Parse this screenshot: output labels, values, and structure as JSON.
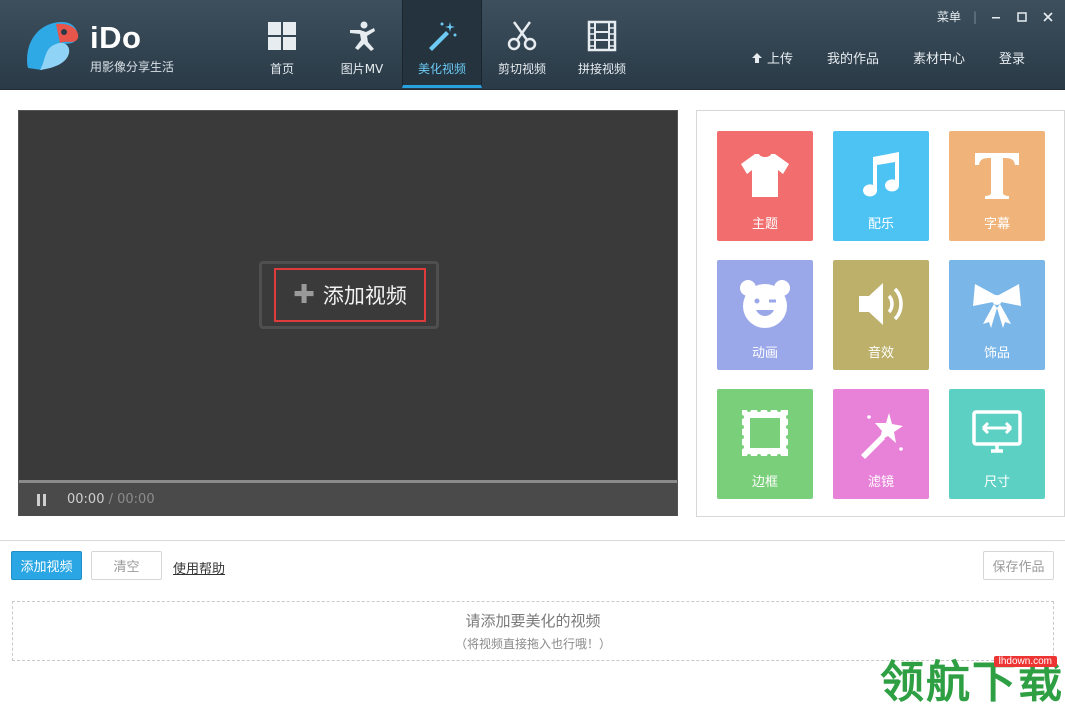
{
  "app": {
    "brand": "iDo",
    "slogan": "用影像分享生活"
  },
  "nav": [
    {
      "label": "首页",
      "icon": "home-grid-icon",
      "active": false
    },
    {
      "label": "图片MV",
      "icon": "dancer-icon",
      "active": false
    },
    {
      "label": "美化视频",
      "icon": "magic-wand-icon",
      "active": true
    },
    {
      "label": "剪切视频",
      "icon": "scissors-icon",
      "active": false
    },
    {
      "label": "拼接视频",
      "icon": "film-strip-icon",
      "active": false
    }
  ],
  "header_links": {
    "upload": "上传",
    "my_works": "我的作品",
    "materials": "素材中心",
    "login": "登录"
  },
  "window": {
    "menu": "菜单"
  },
  "player": {
    "add_video": "添加视频",
    "time_current": "00:00",
    "time_total": "/ 00:00"
  },
  "effects": [
    {
      "label": "主题",
      "icon": "tshirt-icon",
      "color": "#f26e6e"
    },
    {
      "label": "配乐",
      "icon": "music-note-icon",
      "color": "#4dc3f4"
    },
    {
      "label": "字幕",
      "icon": "text-t-icon",
      "color": "#f0b47a"
    },
    {
      "label": "动画",
      "icon": "bear-face-icon",
      "color": "#9aa7e8"
    },
    {
      "label": "音效",
      "icon": "speaker-icon",
      "color": "#bdb06a"
    },
    {
      "label": "饰品",
      "icon": "bow-icon",
      "color": "#7ab6e8"
    },
    {
      "label": "边框",
      "icon": "stamp-frame-icon",
      "color": "#7acf7a"
    },
    {
      "label": "滤镜",
      "icon": "magic-wand-icon",
      "color": "#e882d8"
    },
    {
      "label": "尺寸",
      "icon": "monitor-resize-icon",
      "color": "#5dd0c4"
    }
  ],
  "toolbar": {
    "add_video": "添加视频",
    "clear": "清空",
    "help": "使用帮助",
    "save": "保存作品"
  },
  "dropzone": {
    "main": "请添加要美化的视频",
    "sub": "（将视频直接拖入也行哦！）"
  },
  "watermark": {
    "text": "领航下载",
    "url": "lhdown.com"
  }
}
